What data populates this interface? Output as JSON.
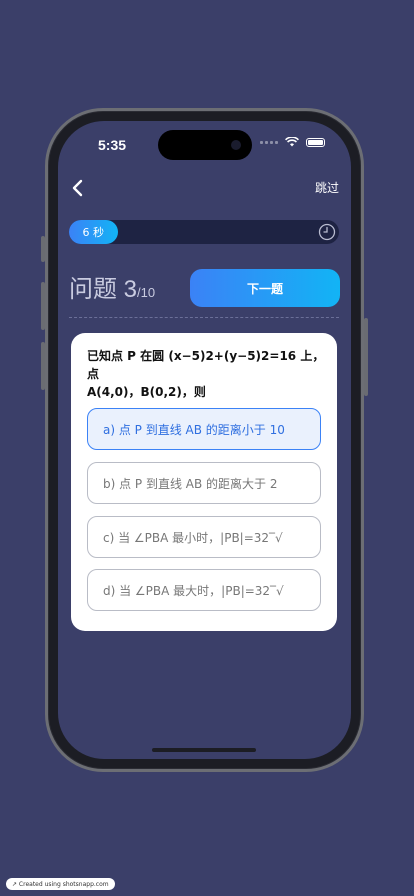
{
  "status": {
    "time": "5:35"
  },
  "header": {
    "skip_label": "跳过"
  },
  "timer": {
    "label": "6 秒",
    "progress_fraction": 0.18
  },
  "quiz": {
    "question_label": "问题 3",
    "total": "/10",
    "next_label": "下一题",
    "question_text_line1": "已知点 P 在圆 (x−5)2+(y−5)2=16 上，点",
    "question_text_line2": "A(4,0)，B(0,2)，则",
    "options": [
      {
        "label": "a) 点 P 到直线 AB 的距离小于 10",
        "selected": true
      },
      {
        "label": "b) 点 P 到直线 AB 的距离大于 2",
        "selected": false
      },
      {
        "label": "c) 当 ∠PBA 最小时，|PB|=32‾√",
        "selected": false
      },
      {
        "label": "d) 当 ∠PBA 最大时，|PB|=32‾√",
        "selected": false
      }
    ]
  },
  "badge": {
    "label": "↗ Created using shotsnapp.com"
  },
  "colors": {
    "background": "#3b3f69",
    "accent": "#3b82f6",
    "accent2": "#12b4f5"
  }
}
